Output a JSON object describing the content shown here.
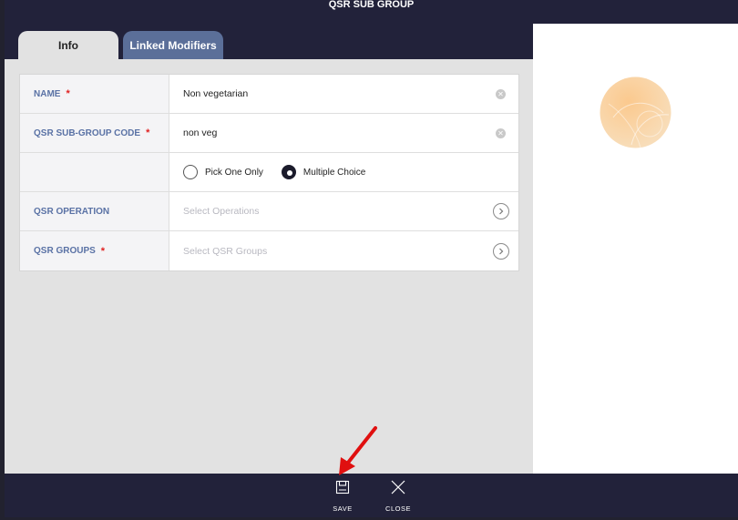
{
  "window": {
    "title": "QSR SUB GROUP"
  },
  "tabs": [
    {
      "label": "Info",
      "active": true
    },
    {
      "label": "Linked Modifiers",
      "active": false
    }
  ],
  "form": {
    "name": {
      "label": "NAME",
      "required": "*",
      "value": "Non vegetarian"
    },
    "code": {
      "label": "QSR SUB-GROUP CODE",
      "required": "*",
      "value": "non veg"
    },
    "choice": {
      "options": [
        "Pick One Only",
        "Multiple Choice"
      ],
      "selected": "Multiple Choice"
    },
    "operation": {
      "label": "QSR OPERATION",
      "placeholder": "Select Operations"
    },
    "groups": {
      "label": "QSR GROUPS",
      "required": "*",
      "placeholder": "Select QSR Groups"
    }
  },
  "footer": {
    "save_label": "SAVE",
    "close_label": "CLOSE"
  },
  "colors": {
    "header_bg": "#22223a",
    "label_text": "#5a72a5",
    "active_tab_bg": "#e2e2e2",
    "inactive_tab_bg": "#5b6f99",
    "required_star": "#e02020",
    "annotation_arrow": "#e01010"
  },
  "icons": {
    "clear": "clear-icon",
    "chevron": "chevron-right-icon",
    "save": "save-icon",
    "close": "close-icon",
    "avatar": "avatar-placeholder-icon"
  }
}
